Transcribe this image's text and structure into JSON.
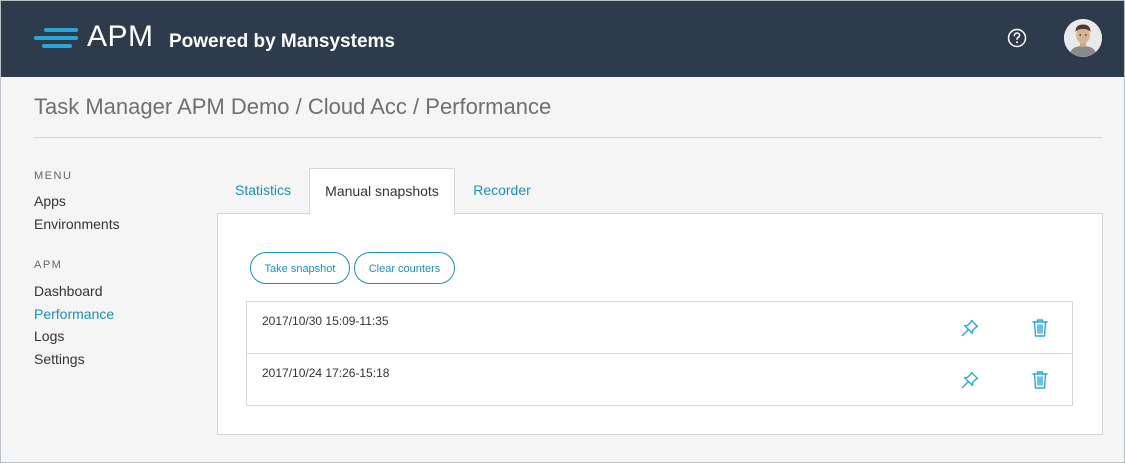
{
  "header": {
    "logo_text": "APM",
    "logo_subtitle": "Powered by Mansystems",
    "help_icon": "question-circle-icon",
    "avatar": "user-avatar"
  },
  "colors": {
    "header_bg": "#2d3b4d",
    "accent": "#1d8fb8",
    "logo_accent": "#2aa7d8"
  },
  "breadcrumb": "Task Manager APM Demo / Cloud Acc / Performance",
  "sidebar": {
    "menu_heading": "MENU",
    "menu_items": [
      {
        "label": "Apps"
      },
      {
        "label": "Environments"
      }
    ],
    "apm_heading": "APM",
    "apm_items": [
      {
        "label": "Dashboard"
      },
      {
        "label": "Performance",
        "active": true
      },
      {
        "label": "Logs"
      },
      {
        "label": "Settings"
      }
    ]
  },
  "tabs": [
    {
      "label": "Statistics"
    },
    {
      "label": "Manual snapshots",
      "active": true
    },
    {
      "label": "Recorder"
    }
  ],
  "actions": {
    "take_snapshot": "Take snapshot",
    "clear_counters": "Clear counters"
  },
  "snapshots": [
    {
      "date": "2017/10/30 15:09-11:35",
      "pin_icon": "pin-icon",
      "delete_icon": "trash-icon"
    },
    {
      "date": "2017/10/24 17:26-15:18",
      "pin_icon": "pin-icon",
      "delete_icon": "trash-icon"
    }
  ]
}
